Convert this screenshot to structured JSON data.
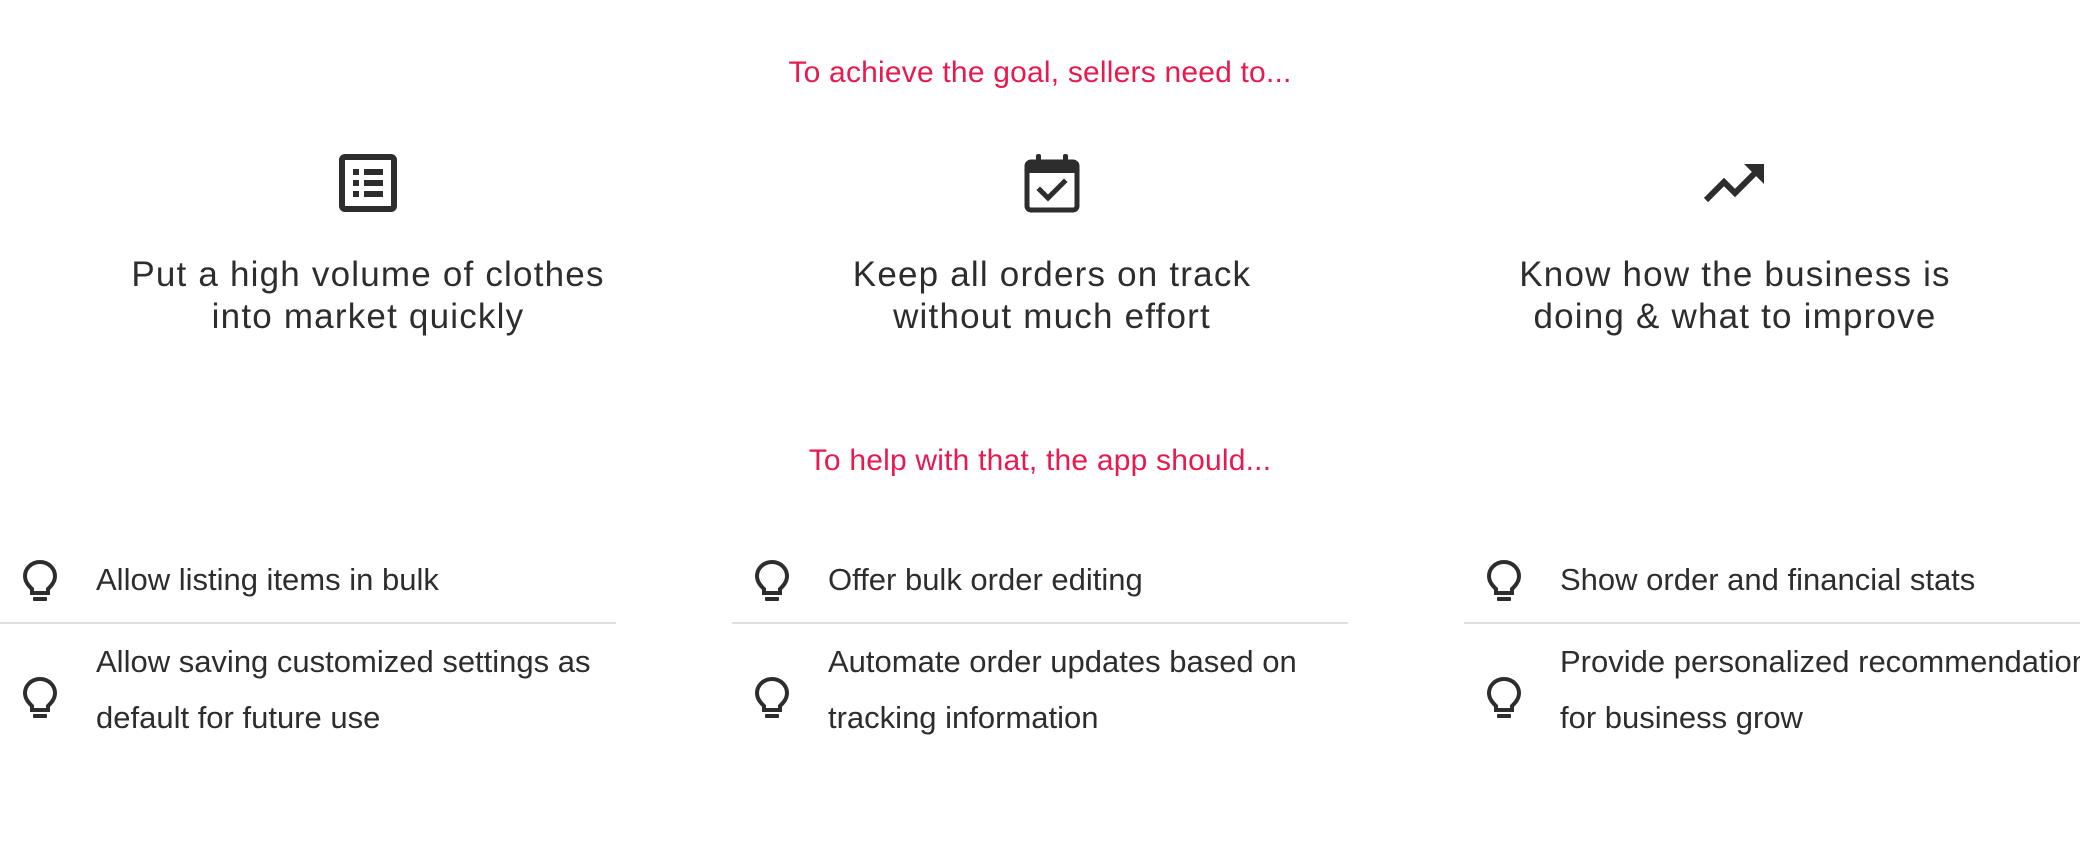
{
  "headings": {
    "goals": "To achieve the goal, sellers need to...",
    "app": "To help with that, the app should..."
  },
  "goals": [
    {
      "icon": "list-icon",
      "line1": "Put a high volume of clothes",
      "line2": "into market quickly"
    },
    {
      "icon": "calendar-check-icon",
      "line1": "Keep all orders on track",
      "line2": "without much effort"
    },
    {
      "icon": "trending-up-icon",
      "line1": "Know how the business is",
      "line2": "doing & what to improve"
    }
  ],
  "features": [
    {
      "items": [
        "Allow listing items in bulk",
        "Allow saving customized settings as default for future use"
      ]
    },
    {
      "items": [
        "Offer bulk order editing",
        "Automate order updates based on tracking information"
      ]
    },
    {
      "items": [
        "Show order and financial stats",
        "Provide personalized recommendations for business grow"
      ]
    }
  ],
  "colors": {
    "accent": "#e8194f",
    "text": "#2d2d2d",
    "divider": "#dedede"
  }
}
